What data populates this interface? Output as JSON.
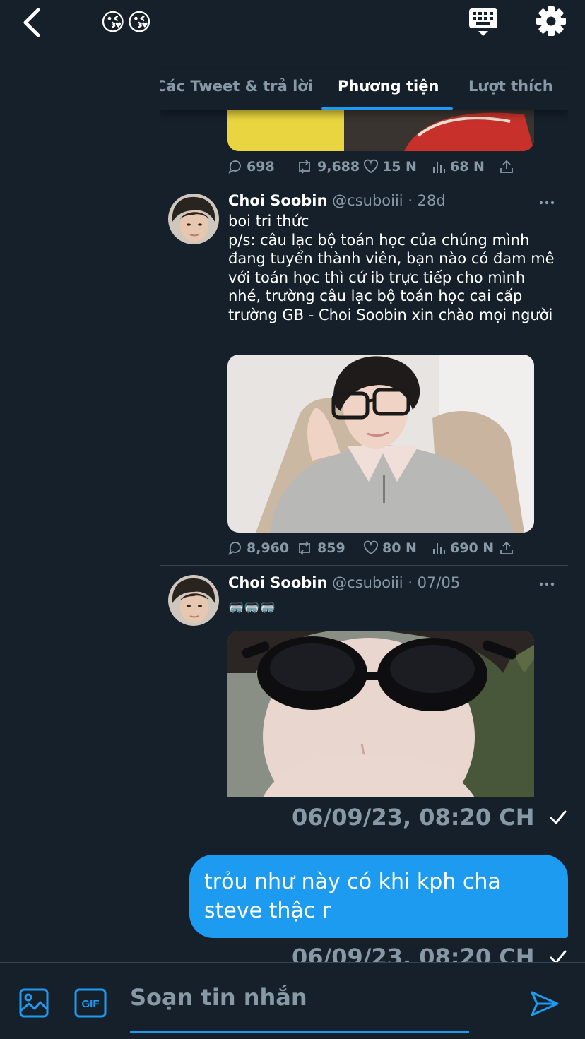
{
  "header": {
    "title_emoji": "😘😘",
    "icons": [
      "back-icon",
      "keyboard-icon",
      "gear-icon"
    ]
  },
  "tweet_card": {
    "tabs": [
      {
        "label": "Các Tweet & trả lời",
        "active": false
      },
      {
        "label": "Phương tiện",
        "active": true
      },
      {
        "label": "Lượt thích",
        "active": false
      }
    ],
    "tweets": [
      {
        "stats": {
          "replies": "698",
          "retweets": "9,688",
          "likes": "15 N",
          "views": "68 N"
        }
      },
      {
        "author": "Choi Soobin",
        "handle": "@csuboiii",
        "time": "· 28d",
        "text": "boi tri thức\np/s: câu lạc bộ toán học của chúng mình đang tuyển thành viên, bạn nào có đam mê với toán học thì cứ ib trực tiếp cho mình nhé, trường câu lạc bộ toán học cai cấp trường GB - Choi Soobin xin chào mọi người",
        "stats": {
          "replies": "8,960",
          "retweets": "859",
          "likes": "80 N",
          "views": "690 N"
        }
      },
      {
        "author": "Choi Soobin",
        "handle": "@csuboiii",
        "time": "· 07/05",
        "text": "🥽🥽🥽"
      }
    ]
  },
  "messages": [
    {
      "timestamp": "06/09/23, 08:20 CH",
      "status": "sent"
    },
    {
      "text": "trỏu như này có khi kph cha steve thậc r",
      "timestamp": "06/09/23, 08:20 CH",
      "status": "sent"
    }
  ],
  "composer": {
    "placeholder": "Soạn tin nhắn",
    "colors": {
      "accent": "#1d9bf0",
      "background": "#15202b",
      "muted": "#8899a6"
    }
  }
}
